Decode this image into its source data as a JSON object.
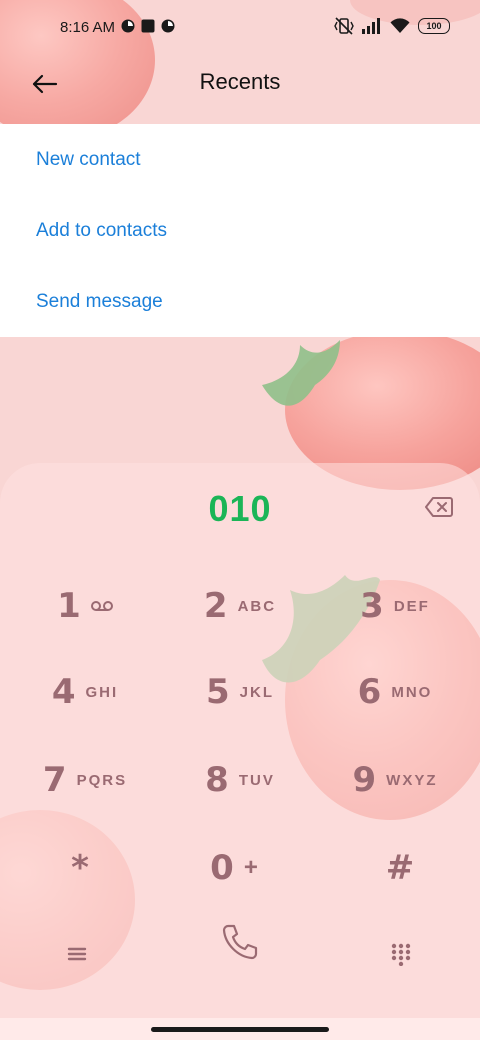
{
  "status_bar": {
    "time": "8:16 AM",
    "battery": "100",
    "left_icons": [
      "app-notification-icon",
      "square-notification-icon",
      "app-notification-icon"
    ],
    "right_icons": [
      "vibrate-off-icon",
      "signal-icon",
      "wifi-icon",
      "battery-icon"
    ]
  },
  "header": {
    "title": "Recents",
    "back_icon": "arrow-left-icon"
  },
  "menu": {
    "items": [
      {
        "label": "New contact"
      },
      {
        "label": "Add to contacts"
      },
      {
        "label": "Send message"
      }
    ]
  },
  "dialer": {
    "number": "010",
    "backspace_icon": "backspace-icon",
    "keys": [
      {
        "digit": "1",
        "letters": "",
        "icon": "voicemail-icon"
      },
      {
        "digit": "2",
        "letters": "ABC"
      },
      {
        "digit": "3",
        "letters": "DEF"
      },
      {
        "digit": "4",
        "letters": "GHI"
      },
      {
        "digit": "5",
        "letters": "JKL"
      },
      {
        "digit": "6",
        "letters": "MNO"
      },
      {
        "digit": "7",
        "letters": "PQRS"
      },
      {
        "digit": "8",
        "letters": "TUV"
      },
      {
        "digit": "9",
        "letters": "WXYZ"
      },
      {
        "digit": "*",
        "letters": ""
      },
      {
        "digit": "0",
        "letters": "+"
      },
      {
        "digit": "#",
        "letters": ""
      }
    ],
    "bottom": {
      "menu_icon": "menu-icon",
      "call_icon": "phone-icon",
      "keypad_icon": "keypad-icon"
    }
  },
  "colors": {
    "accent_blue": "#1b7fd9",
    "number_green": "#1bb557",
    "key_color": "#9a6a72",
    "background": "#f9d6d4"
  }
}
